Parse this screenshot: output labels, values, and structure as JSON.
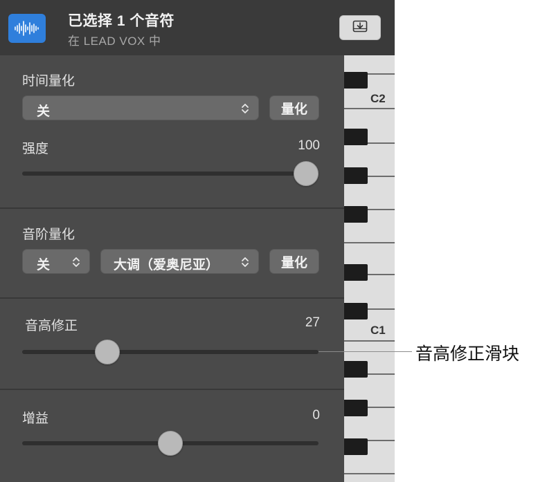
{
  "header": {
    "title": "已选择 1 个音符",
    "subtitle": "在 LEAD VOX 中",
    "region_icon": "waveform-icon",
    "action_icon": "download-tray-icon"
  },
  "time_quantize": {
    "label": "时间量化",
    "value": "关",
    "button": "量化"
  },
  "strength": {
    "label": "强度",
    "value": "100",
    "level": 1.0
  },
  "scale_quantize": {
    "label": "音阶量化",
    "value": "关",
    "scale": "大调（爱奥尼亚）",
    "button": "量化"
  },
  "pitch_correction": {
    "label": "音高修正",
    "value": "27",
    "level": 0.27
  },
  "gain": {
    "label": "增益",
    "value": "0",
    "level": 0.5
  },
  "piano": {
    "labels": [
      "C2",
      "C1"
    ]
  },
  "callout": "音高修正滑块",
  "colors": {
    "panel": "#4a4a4a",
    "header": "#3a3a3a",
    "region_blue": "#2f7fdc"
  }
}
